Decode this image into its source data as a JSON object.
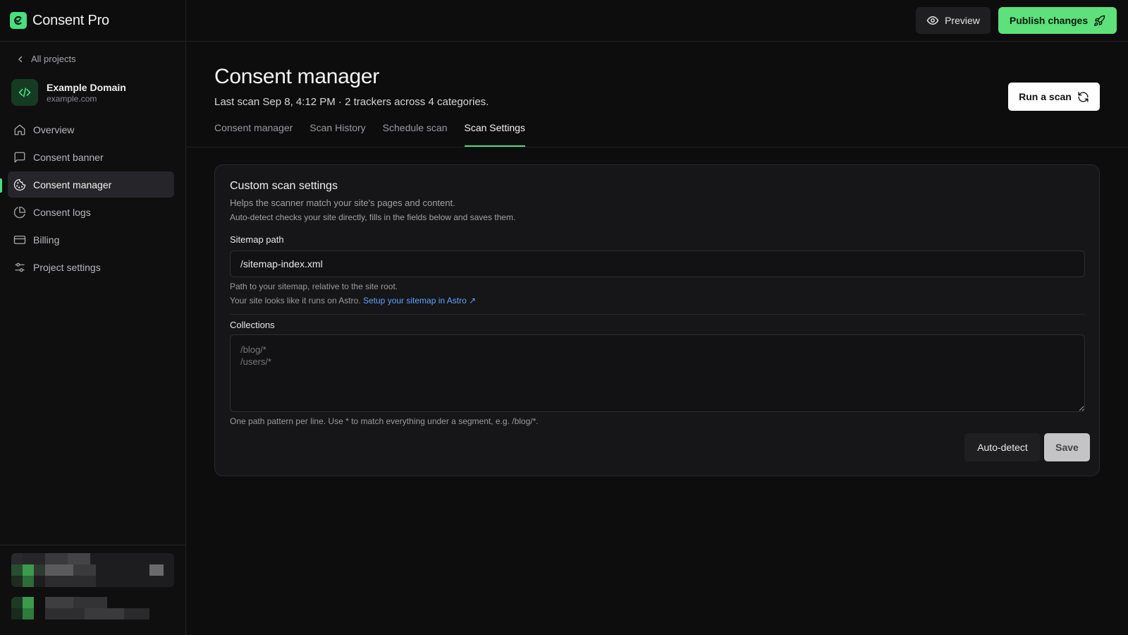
{
  "app": {
    "name": "Consent Pro",
    "accent_color": "#4ade80"
  },
  "topbar": {
    "preview_label": "Preview",
    "publish_label": "Publish changes"
  },
  "sidebar": {
    "back_label": "All projects",
    "project": {
      "name": "Example Domain",
      "domain": "example.com",
      "icon": "code-icon"
    },
    "items": [
      {
        "label": "Overview",
        "icon": "home-icon",
        "active": false
      },
      {
        "label": "Consent banner",
        "icon": "message-square-icon",
        "active": false
      },
      {
        "label": "Consent manager",
        "icon": "cookie-icon",
        "active": true
      },
      {
        "label": "Consent logs",
        "icon": "pie-chart-icon",
        "active": false
      },
      {
        "label": "Billing",
        "icon": "credit-card-icon",
        "active": false
      },
      {
        "label": "Project settings",
        "icon": "sliders-icon",
        "active": false
      }
    ]
  },
  "main": {
    "title": "Consent manager",
    "subtitle": "Last scan Sep 8, 4:12 PM · 2 trackers across 4 categories.",
    "run_scan_label": "Run a scan",
    "tabs": [
      {
        "label": "Consent manager",
        "active": false
      },
      {
        "label": "Scan History",
        "active": false
      },
      {
        "label": "Schedule scan",
        "active": false
      },
      {
        "label": "Scan Settings",
        "active": true
      }
    ],
    "card": {
      "title": "Custom scan settings",
      "description": "Helps the scanner match your site's pages and content.",
      "description2": "Auto-detect checks your site directly, fills in the fields below and saves them.",
      "sitemap": {
        "label": "Sitemap path",
        "value": "/sitemap-index.xml",
        "help": "Path to your sitemap, relative to the site root.",
        "help2_prefix": "Your site looks like it runs on Astro.",
        "help2_link": "Setup your sitemap in Astro ↗"
      },
      "collections": {
        "label": "Collections",
        "placeholder": "/blog/*\n/users/*",
        "help": "One path pattern per line. Use * to match everything under a segment, e.g. /blog/*."
      },
      "auto_detect_label": "Auto-detect",
      "save_label": "Save"
    }
  }
}
